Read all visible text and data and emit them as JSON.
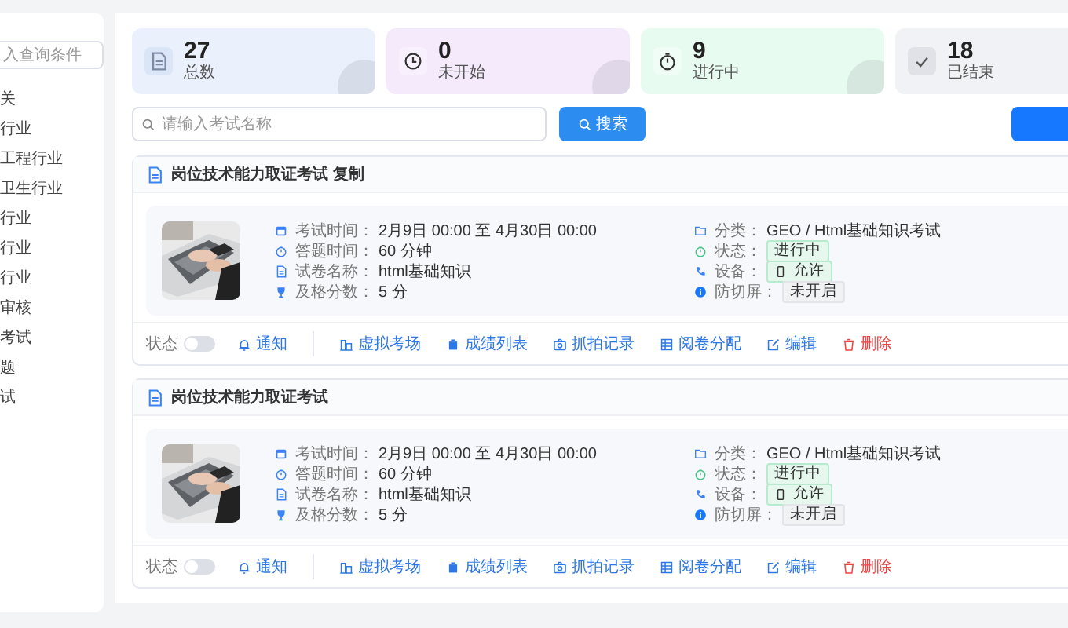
{
  "sidebar": {
    "search": {
      "placeholder": "入查询条件"
    },
    "items": [
      {
        "label": "关"
      },
      {
        "label": "行业"
      },
      {
        "label": "工程行业"
      },
      {
        "label": "卫生行业"
      },
      {
        "label": "行业"
      },
      {
        "label": "行业"
      },
      {
        "label": "行业"
      },
      {
        "label": "审核"
      },
      {
        "label": "考试"
      },
      {
        "label": "题"
      },
      {
        "label": "试"
      }
    ]
  },
  "stats": [
    {
      "kind": "doc",
      "value": "27",
      "label": "总数",
      "color": "#eaf0fc"
    },
    {
      "kind": "clock",
      "value": "0",
      "label": "未开始",
      "color": "#f4eafc"
    },
    {
      "kind": "timer",
      "value": "9",
      "label": "进行中",
      "color": "#e8fbf1"
    },
    {
      "kind": "check",
      "value": "18",
      "label": "已结束",
      "color": "#f1f2f5"
    }
  ],
  "search": {
    "placeholder": "请输入考试名称",
    "button": "搜索"
  },
  "exams": [
    {
      "title": "岗位技术能力取证考试 复制",
      "info": [
        {
          "kind": "calendar",
          "label": "考试时间：",
          "value": "2月9日 00:00 至 4月30日 00:00"
        },
        {
          "kind": "timer",
          "label": "答题时间：",
          "value": "60 分钟"
        },
        {
          "kind": "doc",
          "label": "试卷名称：",
          "value": "html基础知识"
        },
        {
          "kind": "trophy",
          "label": "及格分数：",
          "value": "5 分"
        }
      ],
      "meta": [
        {
          "kind": "text",
          "label": "分类：",
          "value": "GEO / Html基础知识考试"
        },
        {
          "kind": "success",
          "label": "状态：",
          "value": "进行中"
        },
        {
          "kind": "device",
          "label": "设备：",
          "value": "允许"
        },
        {
          "kind": "plain",
          "label": "防切屏：",
          "value": "未开启"
        }
      ],
      "status_label": "状态",
      "on": false,
      "actions": [
        {
          "kind": "notify",
          "label": "通知"
        },
        {
          "kind": "room",
          "label": "虚拟考场"
        },
        {
          "kind": "scores",
          "label": "成绩列表"
        },
        {
          "kind": "camera",
          "label": "抓拍记录"
        },
        {
          "kind": "assign",
          "label": "阅卷分配"
        },
        {
          "kind": "edit",
          "label": "编辑"
        },
        {
          "kind": "delete",
          "label": "删除"
        }
      ]
    },
    {
      "title": "岗位技术能力取证考试",
      "info": [
        {
          "kind": "calendar",
          "label": "考试时间：",
          "value": "2月9日 00:00 至 4月30日 00:00"
        },
        {
          "kind": "timer",
          "label": "答题时间：",
          "value": "60 分钟"
        },
        {
          "kind": "doc",
          "label": "试卷名称：",
          "value": "html基础知识"
        },
        {
          "kind": "trophy",
          "label": "及格分数：",
          "value": "5 分"
        }
      ],
      "meta": [
        {
          "kind": "text",
          "label": "分类：",
          "value": "GEO / Html基础知识考试"
        },
        {
          "kind": "success",
          "label": "状态：",
          "value": "进行中"
        },
        {
          "kind": "device",
          "label": "设备：",
          "value": "允许"
        },
        {
          "kind": "plain",
          "label": "防切屏：",
          "value": "未开启"
        }
      ],
      "status_label": "状态",
      "on": false,
      "actions": [
        {
          "kind": "notify",
          "label": "通知"
        },
        {
          "kind": "room",
          "label": "虚拟考场"
        },
        {
          "kind": "scores",
          "label": "成绩列表"
        },
        {
          "kind": "camera",
          "label": "抓拍记录"
        },
        {
          "kind": "assign",
          "label": "阅卷分配"
        },
        {
          "kind": "edit",
          "label": "编辑"
        },
        {
          "kind": "delete",
          "label": "删除"
        }
      ]
    }
  ]
}
